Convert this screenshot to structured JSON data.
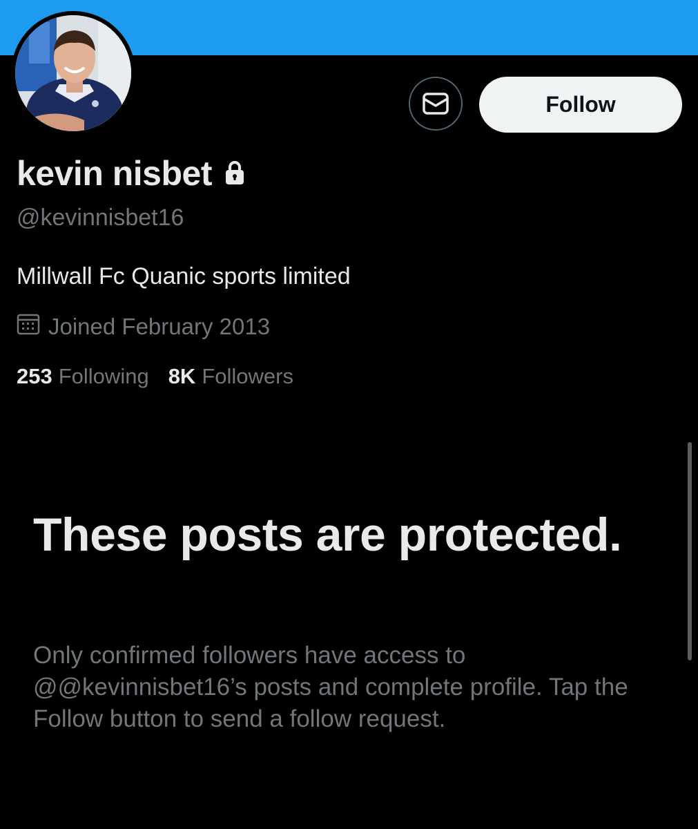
{
  "profile": {
    "display_name": "kevin nisbet",
    "handle": "@kevinnisbet16",
    "bio": "Millwall Fc Quanic sports limited",
    "joined": "Joined February 2013",
    "avatar_desc": "avatar",
    "locked_icon": "lock-icon"
  },
  "actions": {
    "message_icon": "envelope-icon",
    "follow_label": "Follow"
  },
  "stats": {
    "following_count": "253",
    "following_label": "Following",
    "followers_count": "8K",
    "followers_label": "Followers"
  },
  "protected": {
    "title": "These posts are protected.",
    "body": "Only confirmed followers have access to @@kevinnisbet16’s posts and complete profile. Tap the Follow button to send a follow request."
  },
  "colors": {
    "banner": "#1d9bf0",
    "background": "#000000",
    "primary_text": "#e7e9ea",
    "secondary_text": "#71767b",
    "follow_button_bg": "#eff3f4"
  }
}
